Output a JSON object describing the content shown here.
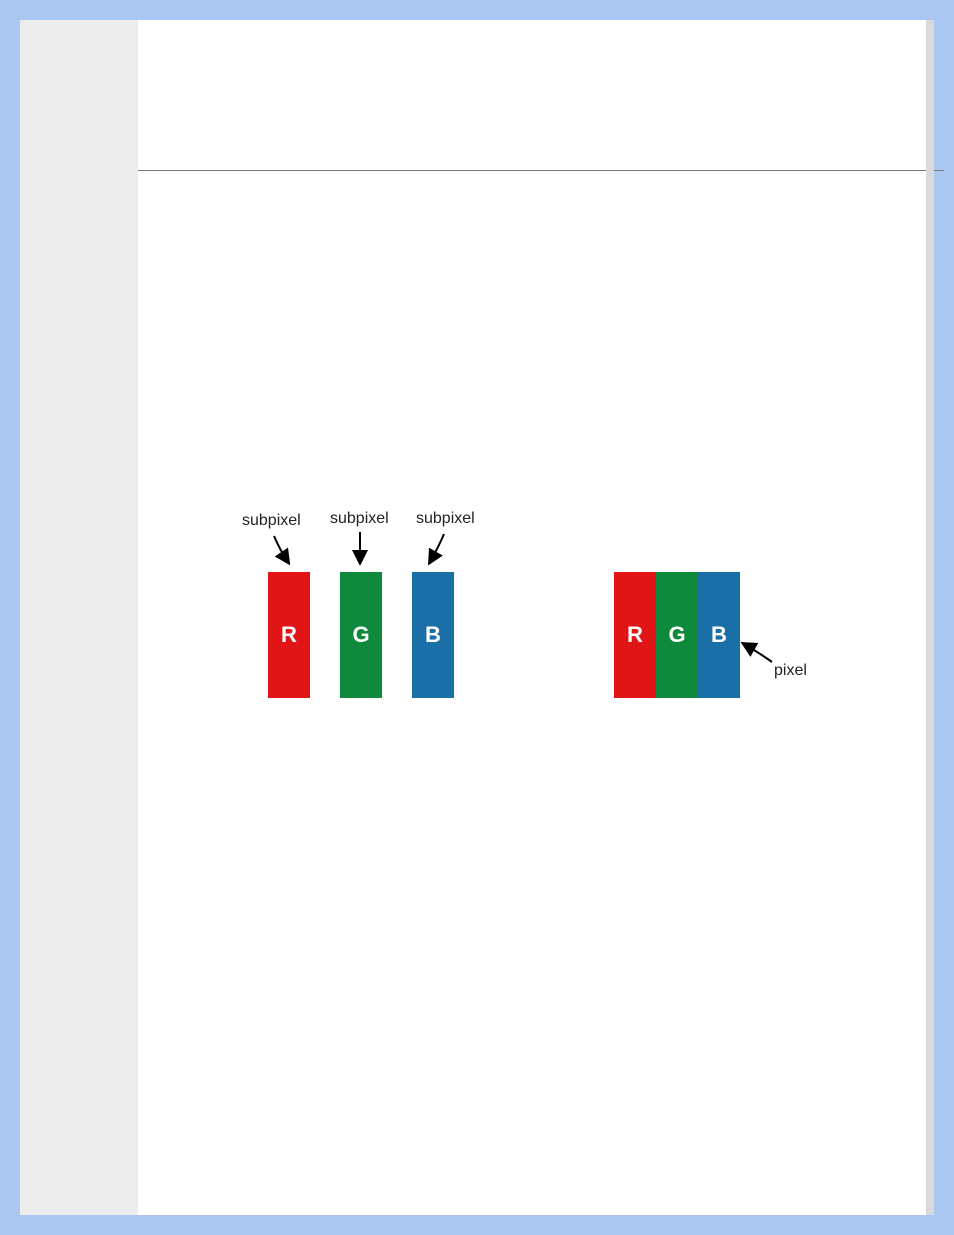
{
  "labels": {
    "subpixel": "subpixel",
    "pixel": "pixel"
  },
  "letters": {
    "r": "R",
    "g": "G",
    "b": "B"
  },
  "colors": {
    "r": "#e11515",
    "g": "#0f8a3c",
    "b": "#1b6fa8"
  }
}
